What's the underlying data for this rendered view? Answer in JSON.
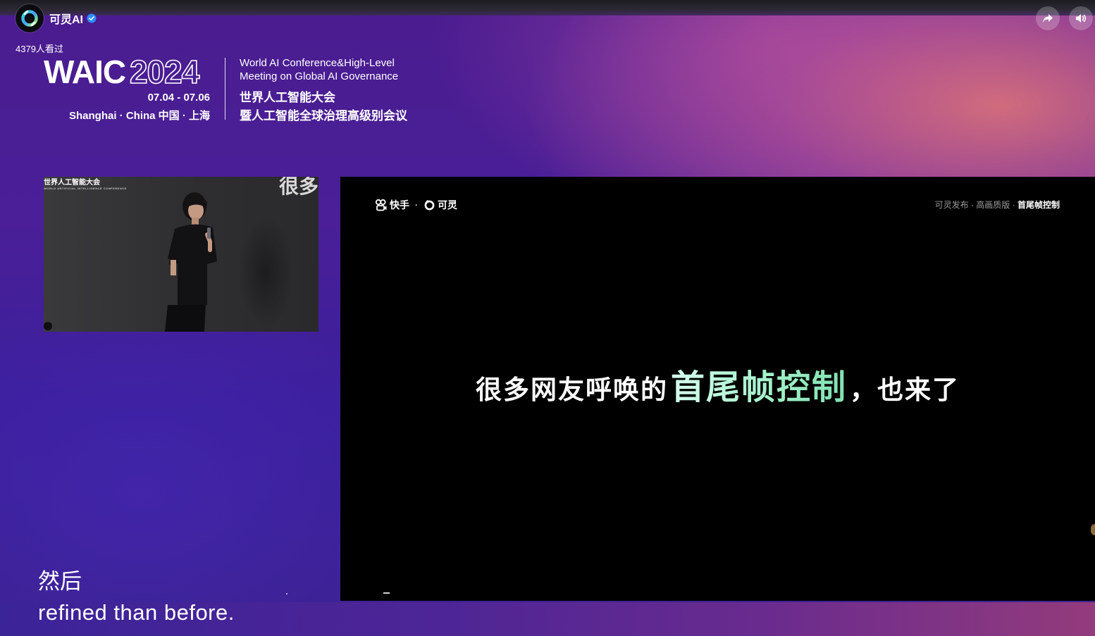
{
  "account": {
    "name": "可灵AI",
    "viewers": "4379人看过",
    "verified_icon": "verified-check-icon"
  },
  "controls": {
    "share_icon": "share-arrow-icon",
    "volume_icon": "volume-icon"
  },
  "waic": {
    "word": "WAIC",
    "year": "2024",
    "dates": "07.04 - 07.06",
    "place": "Shanghai · China  中国 · 上海",
    "en_line1": "World AI Conference&High-Level",
    "en_line2": "Meeting on Global AI Governance",
    "cn_line1": "世界人工智能大会",
    "cn_line2": "暨人工智能全球治理高级别会议"
  },
  "camera": {
    "tag": "世界人工智能大会",
    "tag_sub": "WORLD ARTIFICIAL INTELLIGENCE CONFERENCE",
    "screen_text": "很多"
  },
  "slide": {
    "logo_kuaishou": "快手",
    "logo_separator": "·",
    "logo_keling": "可灵",
    "breadcrumb_1": "可灵发布",
    "breadcrumb_sep1": " · ",
    "breadcrumb_2": "高画质版",
    "breadcrumb_sep2": " · ",
    "breadcrumb_current": "首尾帧控制",
    "headline_part1": "很多网友呼唤的",
    "headline_highlight": "首尾帧控制",
    "headline_part3": "，也来了"
  },
  "subtitles": {
    "cn": "然后",
    "en": "refined than before."
  },
  "colors": {
    "highlight_green": "#9ff0c6",
    "brand_purple": "#4a1c8f",
    "accent_pink": "#e67878"
  }
}
